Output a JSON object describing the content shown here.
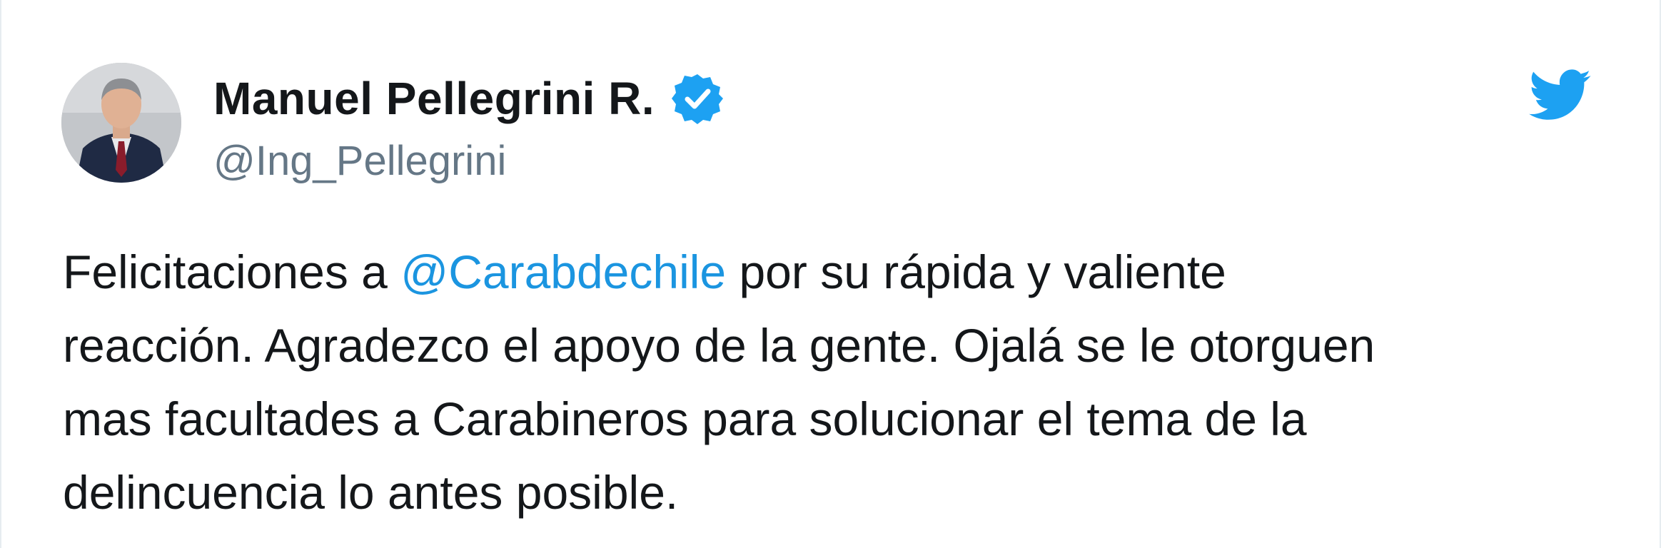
{
  "author": {
    "display_name": "Manuel Pellegrini R.",
    "handle": "@Ing_Pellegrini",
    "verified": true,
    "avatar": "portrait-avatar"
  },
  "brand": {
    "icon": "twitter-bird-icon",
    "color": "#1da1f2"
  },
  "colors": {
    "text": "#14171a",
    "muted": "#657786",
    "link": "#1b95e0",
    "verified_badge": "#1da1f2"
  },
  "tweet": {
    "lines": [
      {
        "before": "Felicitaciones a ",
        "mention": "@Carabdechile",
        "after": " por su rápida y valiente"
      },
      {
        "text": "reacción. Agradezco el apoyo de la gente. Ojalá se le otorguen"
      },
      {
        "text": "mas facultades a Carabineros para solucionar el tema de la"
      },
      {
        "text": "delincuencia lo antes posible."
      }
    ]
  }
}
